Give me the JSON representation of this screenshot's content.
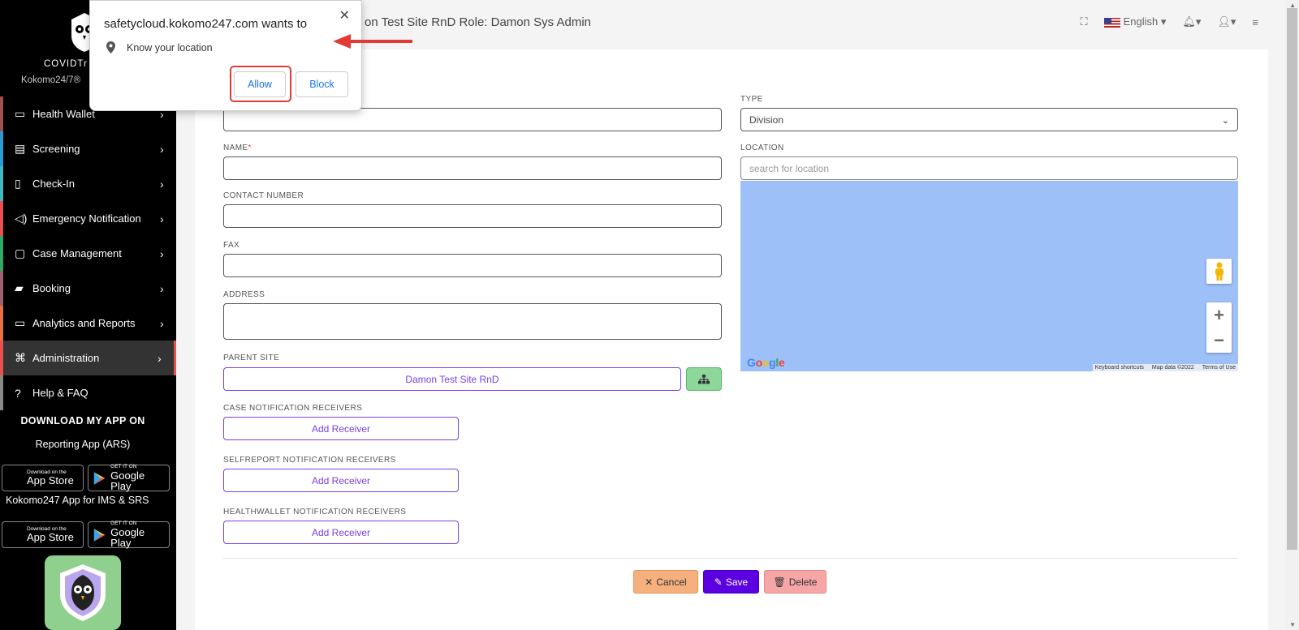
{
  "sidebar": {
    "brand": "COVIDTr",
    "brand_sub": "Kokomo24/7®",
    "items": [
      {
        "label": "Health Wallet",
        "icon": "wallet-icon",
        "color": "#a05050"
      },
      {
        "label": "Screening",
        "icon": "document-icon",
        "color": "#2a9ad6"
      },
      {
        "label": "Check-In",
        "icon": "map-icon",
        "color": "#3fb8c0"
      },
      {
        "label": "Emergency Notification",
        "icon": "megaphone-icon",
        "color": "#e84f4f"
      },
      {
        "label": "Case Management",
        "icon": "file-icon",
        "color": "#2fa86a"
      },
      {
        "label": "Booking",
        "icon": "book-icon",
        "color": "#a06070"
      },
      {
        "label": "Analytics and Reports",
        "icon": "monitor-icon",
        "color": "#e87040"
      },
      {
        "label": "Administration",
        "icon": "command-icon",
        "color": "#e84f4f"
      },
      {
        "label": "Help & FAQ",
        "icon": "help-icon",
        "color": "#888888"
      }
    ],
    "download_title": "DOWNLOAD MY APP ON",
    "app1_label": "Reporting App (ARS)",
    "app2_label": "Kokomo247 App for IMS & SRS",
    "appstore_small": "Download on the",
    "appstore_big": "App Store",
    "googleplay_small": "GET IT ON",
    "googleplay_big": "Google Play"
  },
  "header": {
    "title": "on Test Site RnD   Role: Damon Sys Admin",
    "language": "English"
  },
  "form": {
    "type_label": "TYPE",
    "type_value": "Division",
    "name_label": "NAME",
    "location_label": "LOCATION",
    "location_placeholder": "search for location",
    "contact_label": "CONTACT NUMBER",
    "fax_label": "FAX",
    "address_label": "ADDRESS",
    "parent_site_label": "PARENT SITE",
    "parent_site_value": "Damon Test Site RnD",
    "case_receivers_label": "CASE NOTIFICATION RECEIVERS",
    "selfreport_receivers_label": "SELFREPORT NOTIFICATION RECEIVERS",
    "healthwallet_receivers_label": "HEALTHWALLET NOTIFICATION RECEIVERS",
    "add_receiver": "Add Receiver"
  },
  "map": {
    "keyboard_shortcuts": "Keyboard shortcuts",
    "map_data": "Map data ©2022",
    "terms": "Terms of Use"
  },
  "actions": {
    "cancel": "Cancel",
    "save": "Save",
    "delete": "Delete"
  },
  "popup": {
    "title": "safetycloud.kokomo247.com wants to",
    "permission": "Know your location",
    "allow": "Allow",
    "block": "Block"
  }
}
